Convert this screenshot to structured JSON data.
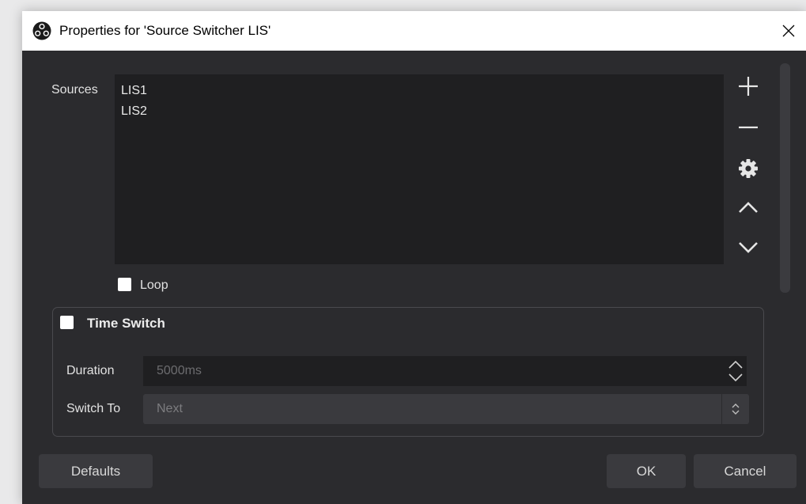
{
  "window": {
    "title": "Properties for 'Source Switcher LIS'",
    "icon": "obs-logo-icon"
  },
  "sources": {
    "label": "Sources",
    "items": [
      "LIS1",
      "LIS2"
    ],
    "tools": [
      "plus-icon",
      "minus-icon",
      "gear-icon",
      "chevron-up-icon",
      "chevron-down-icon"
    ]
  },
  "loop": {
    "label": "Loop",
    "checked": false
  },
  "time_switch": {
    "title": "Time Switch",
    "checked": false,
    "duration_label": "Duration",
    "duration_value": "5000ms",
    "switch_to_label": "Switch To",
    "switch_to_value": "Next"
  },
  "buttons": {
    "defaults": "Defaults",
    "ok": "OK",
    "cancel": "Cancel"
  },
  "colors": {
    "background": "#2b2b2e",
    "field": "#1f1f21",
    "button": "#3a3a3e"
  }
}
